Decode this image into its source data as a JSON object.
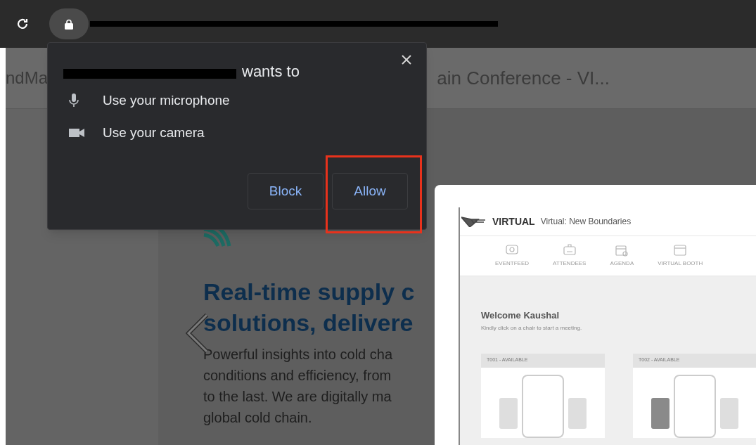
{
  "browser": {
    "page_title_left": "ndMa",
    "page_title_right": "ain Conference - VI..."
  },
  "permission_dialog": {
    "title_suffix": "wants to",
    "permissions": [
      {
        "kind": "microphone",
        "label": "Use your microphone"
      },
      {
        "kind": "camera",
        "label": "Use your camera"
      }
    ],
    "buttons": [
      {
        "kind": "plain",
        "label": "Block"
      },
      {
        "kind": "annotated",
        "label": "Allow"
      }
    ]
  },
  "page": {
    "headline": [
      "Real-time supply c",
      "solutions, delivere"
    ],
    "body": [
      "Powerful insights into cold cha",
      "conditions and efficiency, from",
      "to the last. We are digitally ma",
      "global cold chain."
    ]
  },
  "inset": {
    "brand": "VIRTUAL",
    "event_title": "Virtual: New Boundaries",
    "nav": [
      {
        "kind": "feed",
        "label": "EVENTFEED"
      },
      {
        "kind": "attendees",
        "label": "ATTENDEES"
      },
      {
        "kind": "agenda",
        "label": "AGENDA"
      },
      {
        "kind": "booth",
        "label": "VIRTUAL BOOTH"
      }
    ],
    "welcome": "Welcome Kaushal",
    "hint": "Kindly click on a chair to start a meeting.",
    "tables": [
      {
        "label": "T001 - AVAILABLE",
        "chairs": [
          {
            "occupied": false
          },
          {
            "occupied": false
          }
        ]
      },
      {
        "label": "T002 - AVAILABLE",
        "chairs": [
          {
            "occupied": true
          },
          {
            "occupied": false
          }
        ]
      }
    ]
  }
}
